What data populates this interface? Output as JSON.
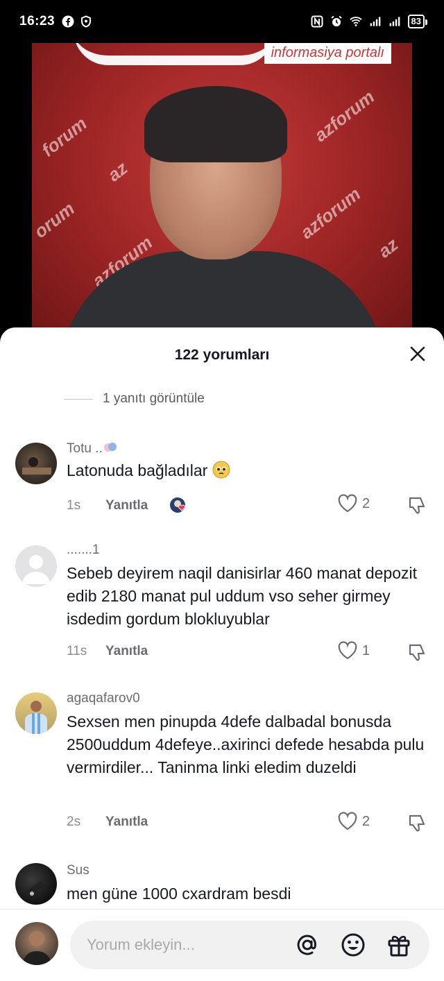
{
  "status_bar": {
    "time": "16:23",
    "battery": "83"
  },
  "video": {
    "brand_text": "informasiya portalı"
  },
  "sheet": {
    "title": "122 yorumları",
    "view_replies": "1 yanıtı görüntüle"
  },
  "comments": [
    {
      "user": "Totu ..",
      "text": "Latonuda bağladılar",
      "time": "1s",
      "reply_label": "Yanıtla",
      "likes": "2"
    },
    {
      "user": ".......1",
      "text": "Sebeb deyirem naqil danisirlar 460 manat depozit edib 2180 manat pul uddum vso seher girmey isdedim gordum blokluyublar",
      "time": "11s",
      "reply_label": "Yanıtla",
      "likes": "1"
    },
    {
      "user": "agaqafarov0",
      "text": "Sexsen men pinupda 4defe dalbadal bonusda 2500uddum 4defeye..axirinci defede hesabda pulu vermirdiler... Taninma linki eledim duzeldi",
      "time": "2s",
      "reply_label": "Yanıtla",
      "likes": "2"
    },
    {
      "user": "Sus",
      "text": "men güne 1000 cxardram besdi"
    }
  ],
  "footer": {
    "input_placeholder": "Yorum ekleyin..."
  },
  "colors": {
    "text_primary": "#161823",
    "text_secondary": "#6b6b73",
    "sheet_bg": "#ffffff",
    "input_bg": "#f1f1f2",
    "video_red": "#b32b2b"
  },
  "icons": [
    "facebook-icon",
    "shield-icon",
    "nfc-icon",
    "alarm-icon",
    "wifi-icon",
    "signal-icon",
    "battery-icon",
    "close-icon",
    "heart-icon",
    "dislike-icon",
    "at-icon",
    "emoji-icon",
    "gift-icon"
  ]
}
